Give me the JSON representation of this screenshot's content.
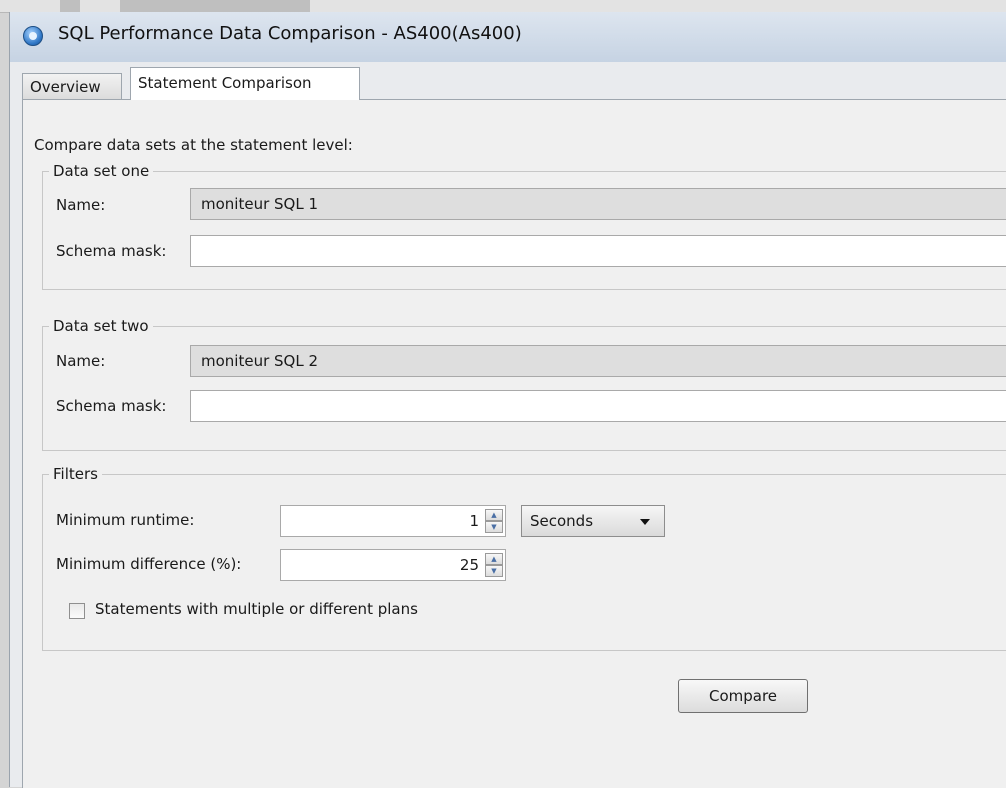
{
  "window": {
    "title": "SQL Performance Data Comparison - AS400(As400)",
    "icon": "app-icon"
  },
  "tabs": [
    {
      "label": "Overview",
      "active": false
    },
    {
      "label": "Statement Comparison",
      "active": true
    }
  ],
  "intro_text": "Compare data sets at the statement level:",
  "data_set_one": {
    "legend": "Data set one",
    "name_label": "Name:",
    "name_value": "moniteur SQL 1",
    "schema_mask_label": "Schema mask:",
    "schema_mask_value": ""
  },
  "data_set_two": {
    "legend": "Data set two",
    "name_label": "Name:",
    "name_value": "moniteur SQL 2",
    "schema_mask_label": "Schema mask:",
    "schema_mask_value": ""
  },
  "filters": {
    "legend": "Filters",
    "min_runtime_label": "Minimum runtime:",
    "min_runtime_value": "1",
    "runtime_unit": "Seconds",
    "min_difference_label": "Minimum difference (%):",
    "min_difference_value": "25",
    "multiple_plans_label": "Statements with multiple or different plans",
    "multiple_plans_checked": false
  },
  "compare_button": "Compare"
}
